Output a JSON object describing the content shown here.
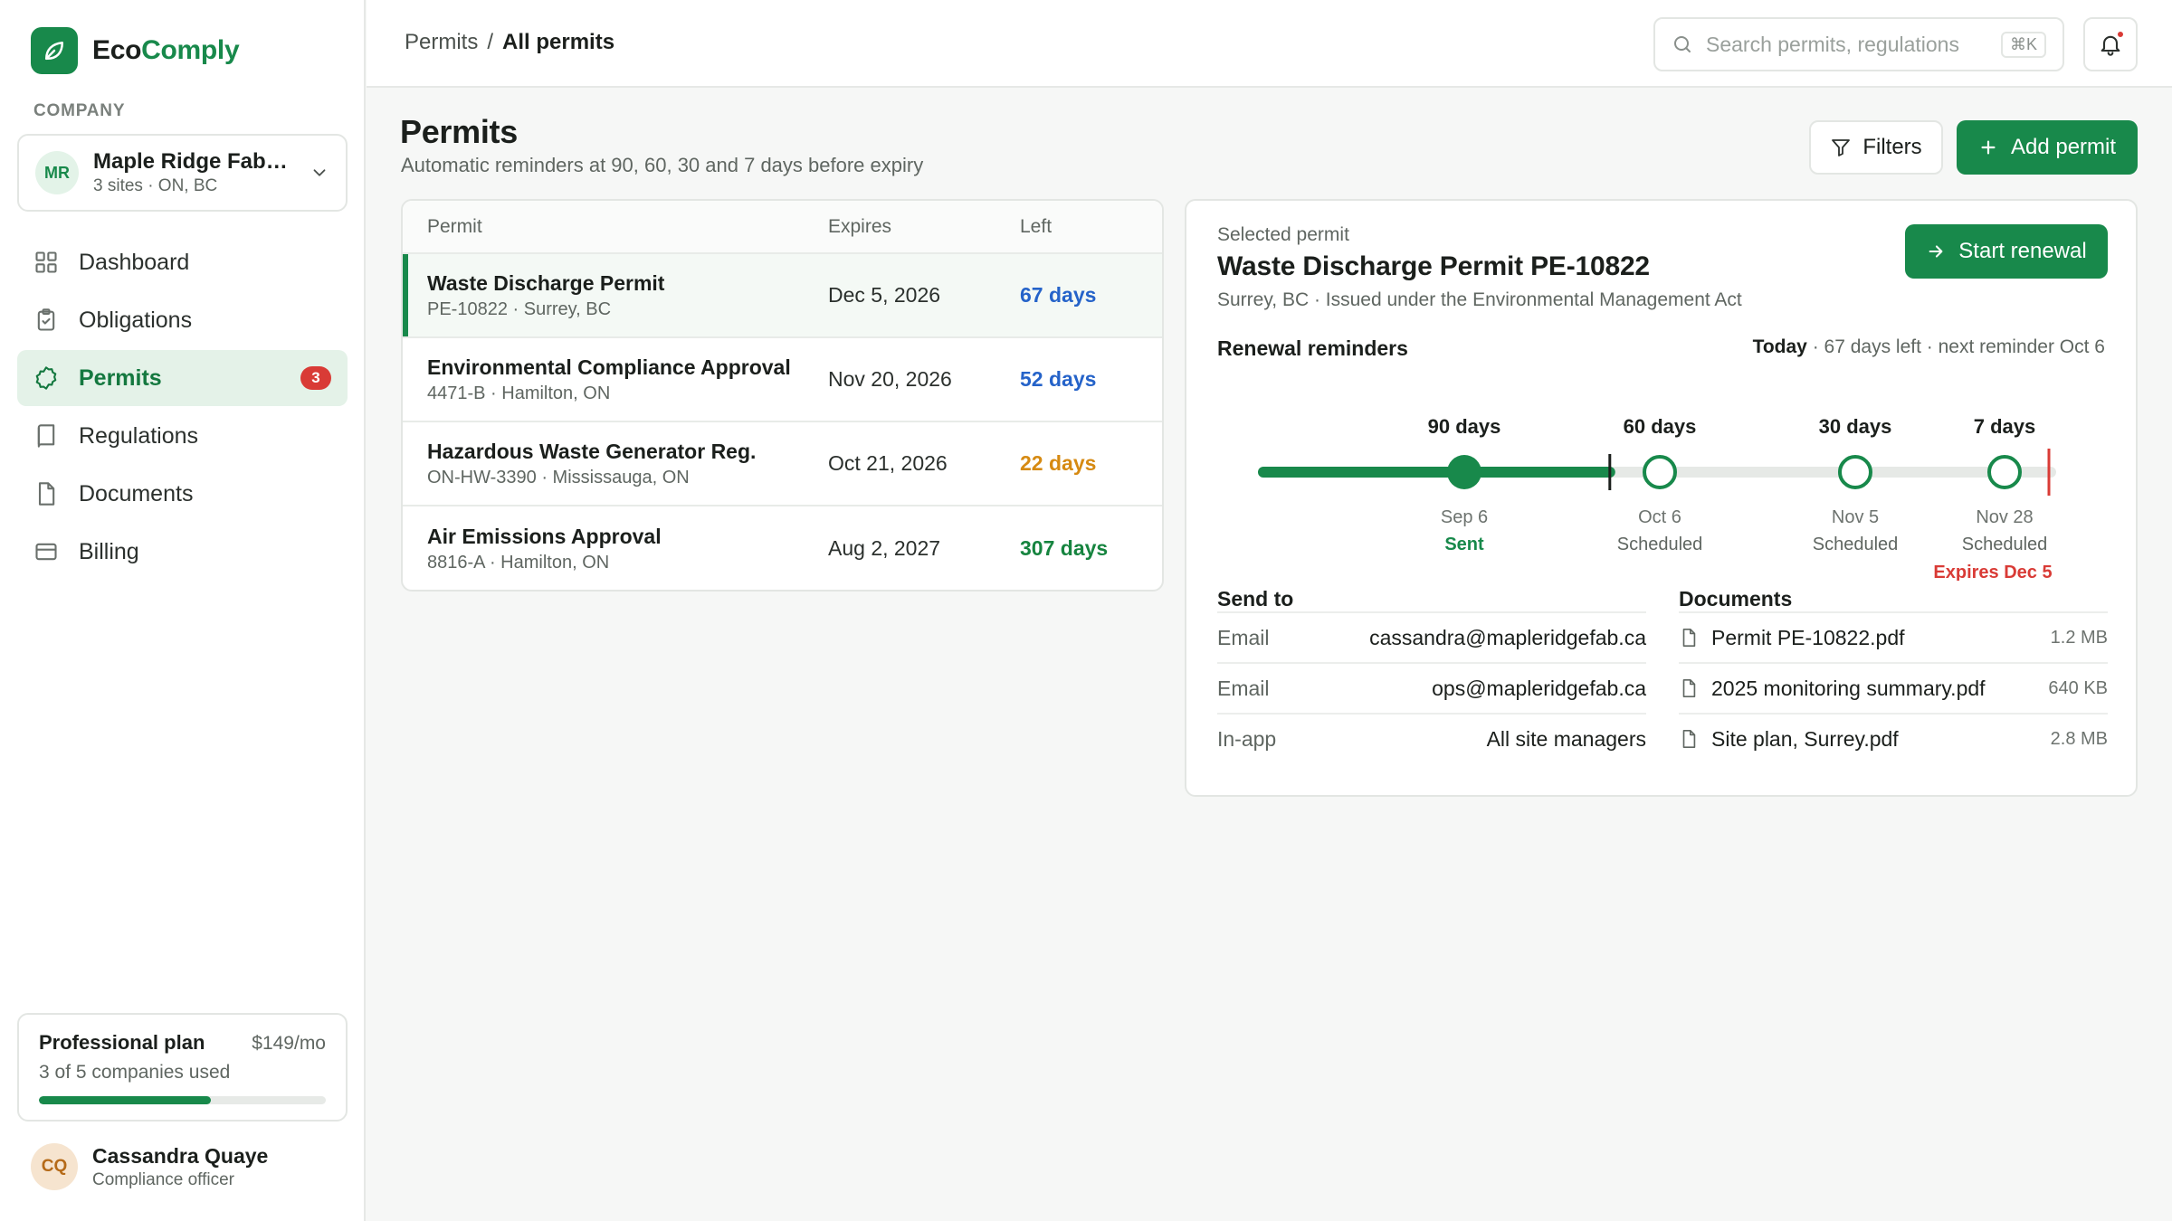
{
  "brand": {
    "prefix": "Eco",
    "accent": "Comply",
    "color": "#18894b"
  },
  "sidebar": {
    "section_label": "COMPANY",
    "company": {
      "initials": "MR",
      "name": "Maple Ridge Fabrication",
      "meta": "3 sites · ON, BC"
    },
    "items": [
      {
        "label": "Dashboard",
        "icon": "grid-icon"
      },
      {
        "label": "Obligations",
        "icon": "clipboard-icon"
      },
      {
        "label": "Permits",
        "icon": "badge-icon",
        "badge": "3",
        "active": true
      },
      {
        "label": "Regulations",
        "icon": "book-icon"
      },
      {
        "label": "Documents",
        "icon": "file-icon"
      },
      {
        "label": "Billing",
        "icon": "card-icon"
      }
    ],
    "plan": {
      "name": "Professional plan",
      "price": "$149/mo",
      "usage": "3 of 5 companies used",
      "fraction": 0.6
    },
    "user": {
      "initials": "CQ",
      "name": "Cassandra Quaye",
      "role": "Compliance officer"
    }
  },
  "topbar": {
    "breadcrumb": {
      "parent": "Permits",
      "sep": "/",
      "current": "All permits"
    },
    "search": {
      "placeholder": "Search permits, regulations",
      "shortcut": "⌘K"
    }
  },
  "main": {
    "title": "Permits",
    "subtitle": "Automatic reminders at 90, 60, 30 and 7 days before expiry",
    "filters_label": "Filters",
    "add_label": "Add permit",
    "table": {
      "headers": {
        "permit": "Permit",
        "expires": "Expires",
        "left": "Left"
      },
      "rows": [
        {
          "name": "Waste Discharge Permit",
          "meta": "PE-10822 · Surrey, BC",
          "expires": "Dec 5, 2026",
          "left": "67 days",
          "left_color": "#2563c9",
          "selected": true
        },
        {
          "name": "Environmental Compliance Approval",
          "meta": "4471-B · Hamilton, ON",
          "expires": "Nov 20, 2026",
          "left": "52 days",
          "left_color": "#2563c9"
        },
        {
          "name": "Hazardous Waste Generator Reg.",
          "meta": "ON-HW-3390 · Mississauga, ON",
          "expires": "Oct 21, 2026",
          "left": "22 days",
          "left_color": "#d68a12"
        },
        {
          "name": "Air Emissions Approval",
          "meta": "8816-A · Hamilton, ON",
          "expires": "Aug 2, 2027",
          "left": "307 days",
          "left_color": "#16843f"
        }
      ]
    },
    "detail": {
      "label": "Selected permit",
      "title": "Waste Discharge Permit PE-10822",
      "subtitle": "Surrey, BC · Issued under the Environmental Management Act",
      "renew_label": "Start renewal",
      "reminders_title": "Renewal reminders",
      "today_label": "Today",
      "today_rest": " · 67 days left · next reminder Oct 6",
      "timeline": {
        "progress_fraction": 0.44,
        "milestones": [
          {
            "days": "90 days",
            "date": "Sep 6",
            "status": "Sent",
            "done": true
          },
          {
            "days": "60 days",
            "date": "Oct 6",
            "status": "Scheduled",
            "done": false
          },
          {
            "days": "30 days",
            "date": "Nov 5",
            "status": "Scheduled",
            "done": false
          },
          {
            "days": "7 days",
            "date": "Nov 28",
            "status": "Scheduled",
            "done": false
          }
        ],
        "expires_label": "Expires Dec 5"
      },
      "send_to": {
        "title": "Send to",
        "rows": [
          {
            "key": "Email",
            "value": "cassandra@mapleridgefab.ca"
          },
          {
            "key": "Email",
            "value": "ops@mapleridgefab.ca"
          },
          {
            "key": "In-app",
            "value": "All site managers"
          }
        ]
      },
      "documents": {
        "title": "Documents",
        "rows": [
          {
            "name": "Permit PE-10822.pdf",
            "size": "1.2 MB"
          },
          {
            "name": "2025 monitoring summary.pdf",
            "size": "640 KB"
          },
          {
            "name": "Site plan, Surrey.pdf",
            "size": "2.8 MB"
          }
        ]
      }
    }
  }
}
